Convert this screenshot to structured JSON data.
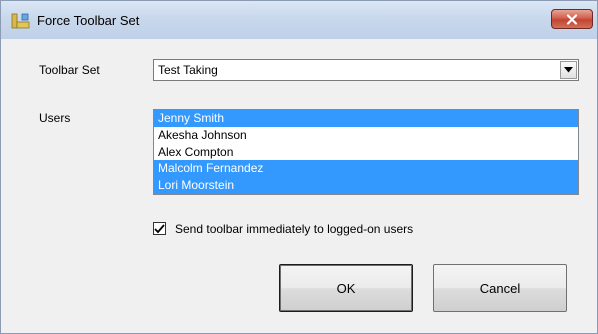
{
  "window": {
    "title": "Force Toolbar Set",
    "close_icon": "close-x-icon",
    "app_icon": "toolbar-app-icon"
  },
  "form": {
    "toolbar_set_label": "Toolbar Set",
    "toolbar_set_value": "Test Taking",
    "users_label": "Users",
    "users": [
      {
        "name": "Jenny Smith",
        "selected": true
      },
      {
        "name": "Akesha Johnson",
        "selected": false
      },
      {
        "name": "Alex Compton",
        "selected": false
      },
      {
        "name": "Malcolm Fernandez",
        "selected": true
      },
      {
        "name": "Lori Moorstein",
        "selected": true
      }
    ],
    "send_immediately_label": "Send toolbar immediately to logged-on users",
    "send_immediately_checked": true
  },
  "buttons": {
    "ok_label": "OK",
    "cancel_label": "Cancel"
  },
  "colors": {
    "selection": "#3399ff",
    "title_bar": "#c9d8ec",
    "close_button": "#c2442f"
  }
}
